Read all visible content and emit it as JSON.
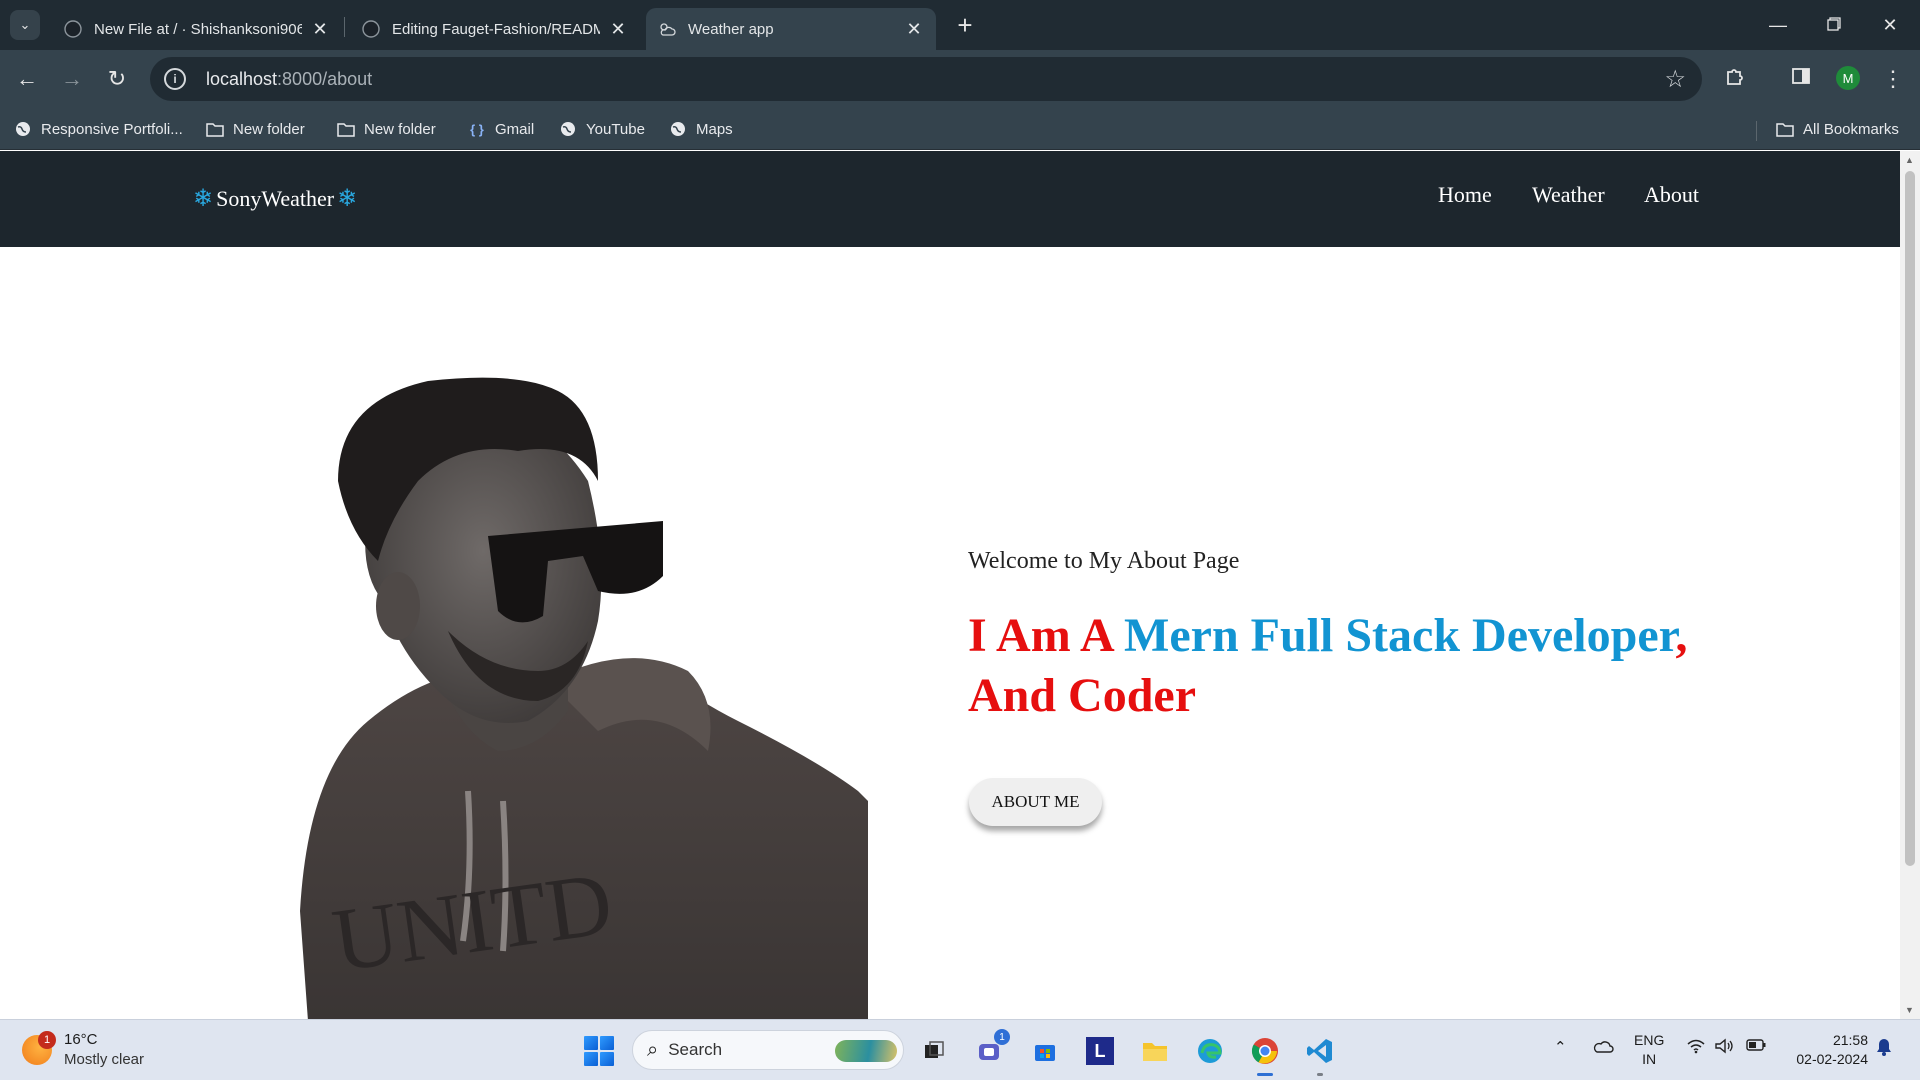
{
  "browser": {
    "tabs": [
      {
        "title": "New File at / · Shishanksoni906/",
        "icon": "github-icon",
        "active": false
      },
      {
        "title": "Editing Fauget-Fashion/README",
        "icon": "github-icon",
        "active": false
      },
      {
        "title": "Weather app",
        "icon": "cloud-sun-icon",
        "active": true
      }
    ],
    "url_host": "localhost",
    "url_path": ":8000/about",
    "profile_initial": "M",
    "bookmarks": [
      {
        "label": "Responsive Portfoli...",
        "icon": "globe-icon"
      },
      {
        "label": "New folder",
        "icon": "folder-icon"
      },
      {
        "label": "New folder",
        "icon": "folder-icon"
      },
      {
        "label": "Gmail",
        "icon": "gmail-icon"
      },
      {
        "label": "YouTube",
        "icon": "globe-icon"
      },
      {
        "label": "Maps",
        "icon": "globe-icon"
      }
    ],
    "all_bookmarks": "All Bookmarks"
  },
  "site": {
    "brand": "SonyWeather",
    "brand_icon": "snowflake-icon",
    "nav": [
      "Home",
      "Weather",
      "About"
    ],
    "welcome": "Welcome to My About Page",
    "headline": {
      "part1": "I Am A ",
      "part2": "Mern Full Stack Developer",
      "part3": ", And Coder"
    },
    "button": "ABOUT ME",
    "colors": {
      "nav_bg": "#1d262d",
      "accent_red": "#e60f0f",
      "accent_blue": "#1294d2",
      "snow": "#29a8e0"
    }
  },
  "taskbar": {
    "weather_temp": "16°C",
    "weather_desc": "Mostly clear",
    "weather_badge": "1",
    "search_label": "Search",
    "teams_badge": "1",
    "lang_top": "ENG",
    "lang_bottom": "IN",
    "time": "21:58",
    "date": "02-02-2024"
  }
}
